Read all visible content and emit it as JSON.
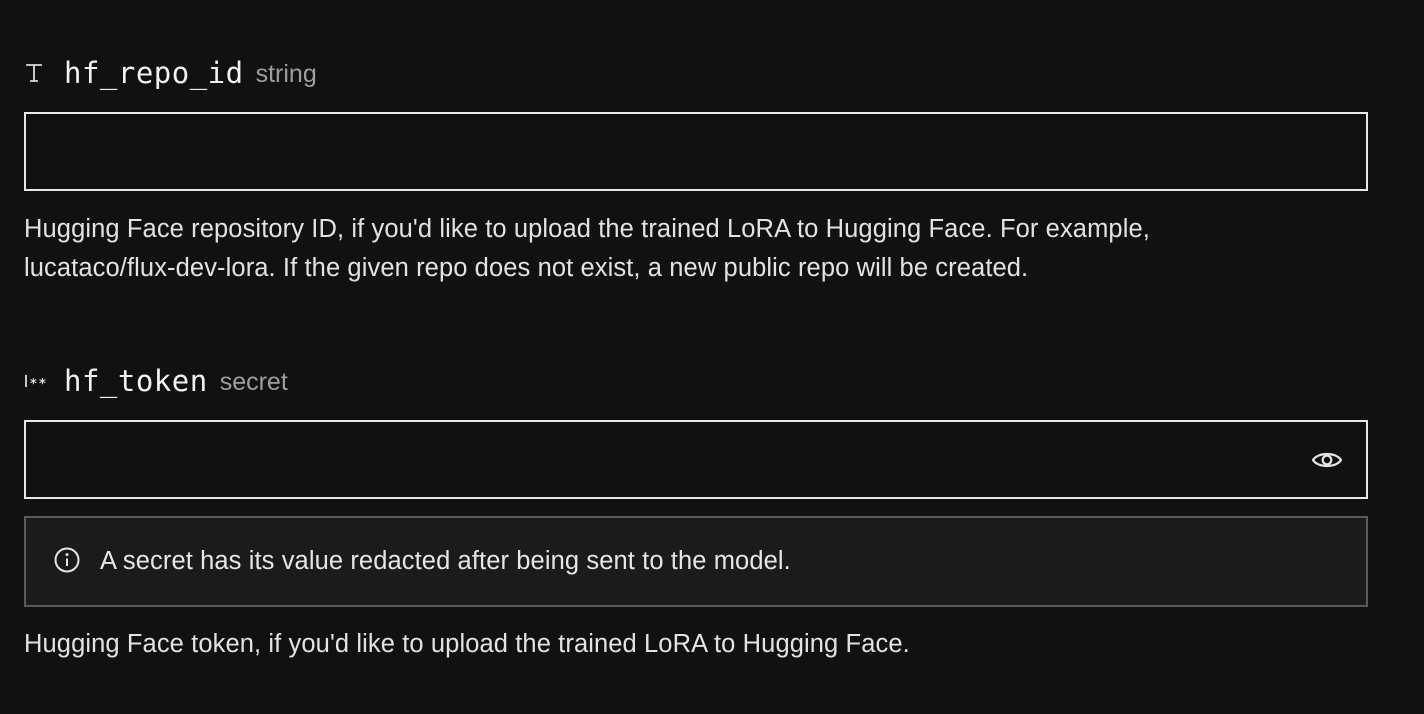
{
  "fields": [
    {
      "name": "hf_repo_id",
      "type": "string",
      "type_icon": "text-type-icon",
      "value": "",
      "placeholder": "",
      "description_line1": "Hugging Face repository ID, if you'd like to upload the trained LoRA to Hugging Face. For example,",
      "description_line2": "lucataco/flux-dev-lora. If the given repo does not exist, a new public repo will be created."
    },
    {
      "name": "hf_token",
      "type": "secret",
      "type_icon": "secret-type-icon",
      "value": "",
      "placeholder": "",
      "reveal_icon": "eye-icon",
      "notice_icon": "info-icon",
      "notice": "A secret has its value redacted after being sent to the model.",
      "description": "Hugging Face token, if you'd like to upload the trained LoRA to Hugging Face."
    }
  ],
  "colors": {
    "background": "#111111",
    "border": "#e8e8e8",
    "notice_background": "#1b1b1b",
    "notice_border": "#5a5a5a",
    "muted_text": "#9e9e9e"
  }
}
